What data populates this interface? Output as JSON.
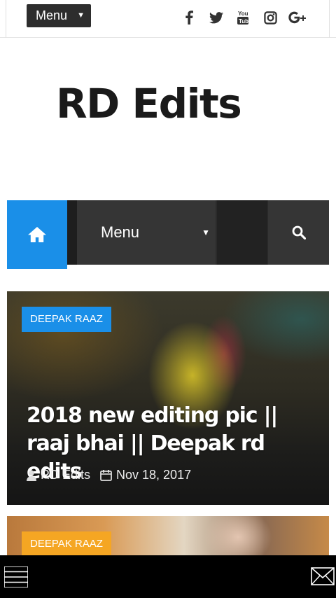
{
  "topbar": {
    "menu_label": "Menu",
    "social_icons": [
      "facebook-icon",
      "twitter-icon",
      "youtube-icon",
      "instagram-icon",
      "google-plus-icon"
    ]
  },
  "site": {
    "title": "RD Edits"
  },
  "nav": {
    "menu_label": "Menu"
  },
  "posts": [
    {
      "category": "DEEPAK RAAZ",
      "title": "2018 new editing pic || raaj bhai || Deepak rd edits",
      "author": "RD Edits",
      "date": "Nov 18, 2017"
    },
    {
      "category": "DEEPAK RAAZ"
    }
  ],
  "colors": {
    "accent_blue": "#1a8fe8",
    "badge_orange": "#f5a623",
    "nav_dark": "#2b2b2b"
  }
}
